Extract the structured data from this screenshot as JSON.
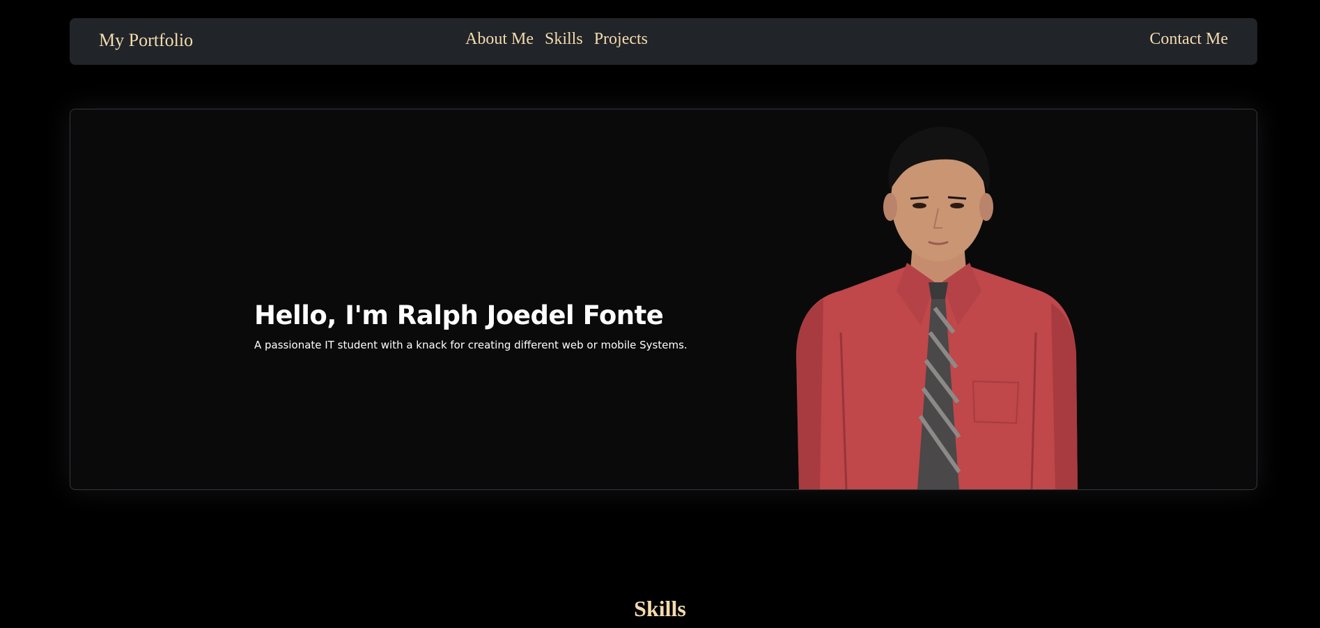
{
  "navbar": {
    "brand": "My Portfolio",
    "links": [
      "About Me",
      "Skills",
      "Projects"
    ],
    "contact": "Contact Me"
  },
  "hero": {
    "heading": "Hello, I'm Ralph Joedel Fonte",
    "subheading": "A passionate IT student with a knack for creating different web or mobile Systems."
  },
  "skills": {
    "title": "Skills"
  },
  "colors": {
    "accent": "#f3dcae",
    "navbar_bg": "#212429",
    "hero_bg": "#0a0a0b",
    "page_bg": "#000000",
    "shirt": "#c0474a"
  }
}
